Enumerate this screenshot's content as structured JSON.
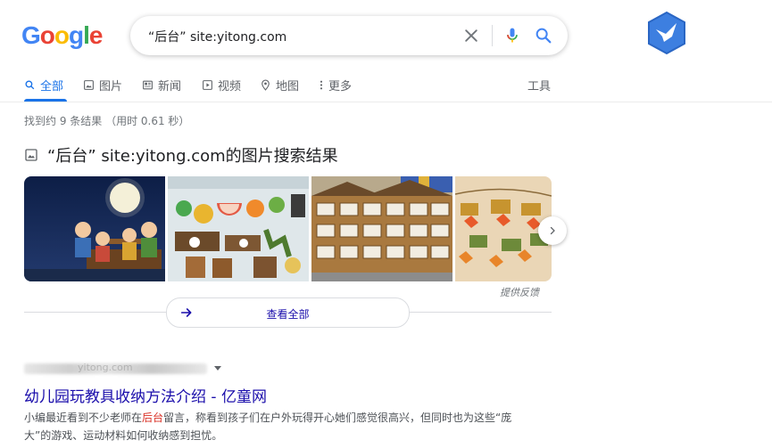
{
  "logo": {
    "letters": [
      "G",
      "o",
      "o",
      "g",
      "l",
      "e"
    ],
    "colors": [
      "#4285F4",
      "#EA4335",
      "#FBBC05",
      "#4285F4",
      "#34A853",
      "#EA4335"
    ]
  },
  "search": {
    "query": "“后台” site:yitong.com"
  },
  "tabs": [
    {
      "label": "全部",
      "icon": "search-icon"
    },
    {
      "label": "图片",
      "icon": "image-icon"
    },
    {
      "label": "新闻",
      "icon": "news-icon"
    },
    {
      "label": "视频",
      "icon": "play-icon"
    },
    {
      "label": "地图",
      "icon": "map-pin-icon"
    },
    {
      "label": "更多",
      "icon": "more-vert-icon"
    }
  ],
  "tools_label": "工具",
  "stats": "找到约 9 条结果  （用时 0.61 秒）",
  "image_section": {
    "heading": "“后台” site:yitong.com的图片搜索结果",
    "feedback": "提供反馈",
    "view_all": "查看全部"
  },
  "result": {
    "cite": "yitong.com",
    "title": "幼儿园玩教具收纳方法介绍 - 亿童网",
    "snippet_pre": "小编最近看到不少老师在",
    "snippet_hl": "后台",
    "snippet_post": "留言，称看到孩子们在户外玩得开心她们感觉很高兴，但同时也为这些“庞大”的游戏、运动材料如何收纳感到担忧。"
  },
  "colors": {
    "accent": "#1a73e8",
    "link": "#1a0dab",
    "highlight": "#d93025"
  }
}
